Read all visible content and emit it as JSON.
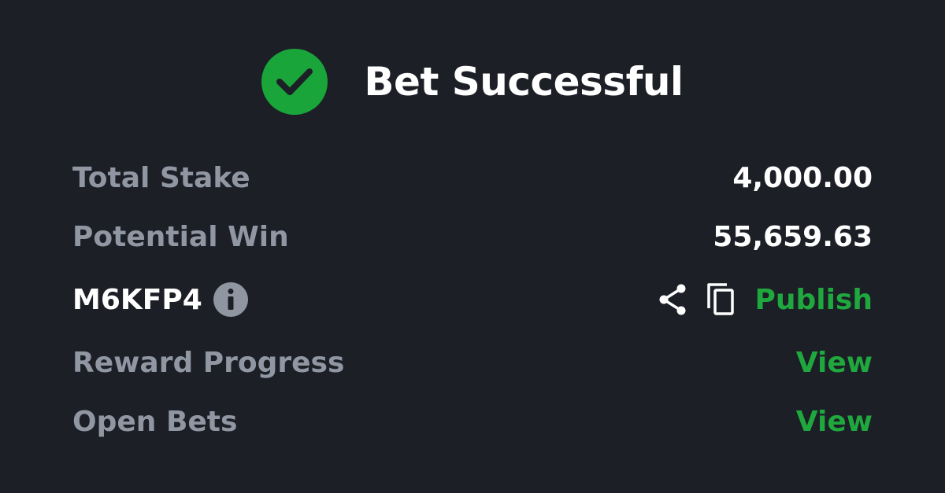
{
  "header": {
    "title": "Bet Successful",
    "icon": "check-circle-icon",
    "accent_color": "#19a53a"
  },
  "summary": {
    "total_stake_label": "Total Stake",
    "total_stake_value": "4,000.00",
    "potential_win_label": "Potential Win",
    "potential_win_value": "55,659.63"
  },
  "booking": {
    "code": "M6KFP4",
    "info_icon": "info-icon",
    "share_icon": "share-icon",
    "copy_icon": "copy-icon",
    "publish_label": "Publish"
  },
  "links": {
    "reward_progress_label": "Reward Progress",
    "reward_progress_action": "View",
    "open_bets_label": "Open Bets",
    "open_bets_action": "View"
  },
  "colors": {
    "background": "#1c1f26",
    "muted_text": "#9097a3",
    "link_green": "#1fa83d"
  }
}
